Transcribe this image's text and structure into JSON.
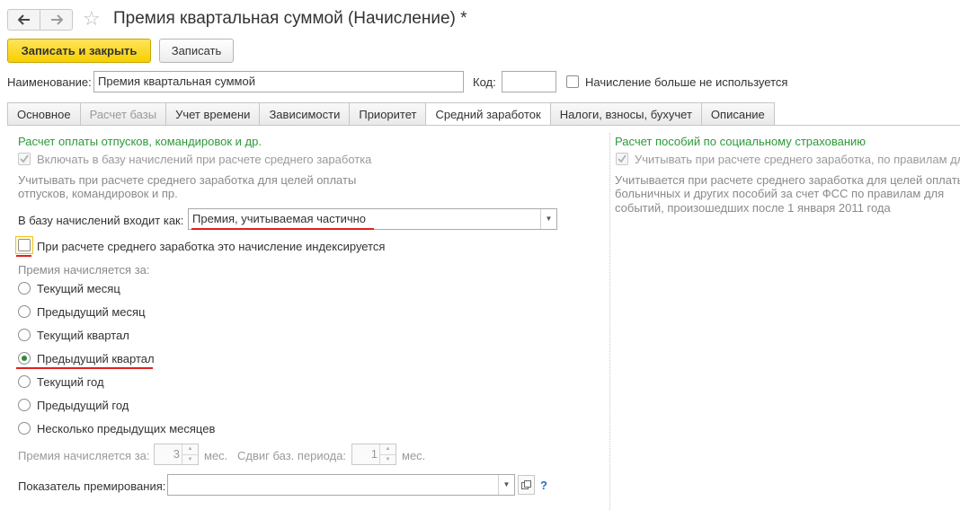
{
  "header": {
    "title": "Премия квартальная суммой (Начисление) *",
    "back_icon": "arrow-left-icon",
    "forward_icon": "arrow-right-icon",
    "favorite_icon": "star-icon"
  },
  "toolbar": {
    "save_close_label": "Записать и закрыть",
    "save_label": "Записать"
  },
  "top_fields": {
    "name_label": "Наименование:",
    "name_value": "Премия квартальная суммой",
    "code_label": "Код:",
    "code_value": "",
    "unused_label": "Начисление больше не используется"
  },
  "tabs": [
    {
      "label": "Основное"
    },
    {
      "label": "Расчет базы"
    },
    {
      "label": "Учет времени"
    },
    {
      "label": "Зависимости"
    },
    {
      "label": "Приоритет"
    },
    {
      "label": "Средний заработок"
    },
    {
      "label": "Налоги, взносы, бухучет"
    },
    {
      "label": "Описание"
    }
  ],
  "left": {
    "section_title": "Расчет оплаты отпусков, командировок и др.",
    "include_label": "Включать в базу начислений при расчете среднего заработка",
    "hint_line1": "Учитывать при расчете среднего заработка для целей оплаты",
    "hint_line2": "отпусков, командировок и пр.",
    "base_label": "В базу начислений входит как:",
    "base_value": "Премия, учитываемая частично",
    "indexed_label": "При расчете среднего заработка это начисление индексируется",
    "period_label": "Премия начисляется за:",
    "radio_options": [
      {
        "label": "Текущий месяц"
      },
      {
        "label": "Предыдущий месяц"
      },
      {
        "label": "Текущий квартал"
      },
      {
        "label": "Предыдущий квартал"
      },
      {
        "label": "Текущий год"
      },
      {
        "label": "Предыдущий год"
      },
      {
        "label": "Несколько предыдущих месяцев"
      }
    ],
    "selected_option": "Предыдущий квартал",
    "months_label": "Премия начисляется за:",
    "months_value": "3",
    "months_unit": "мес.",
    "shift_label": "Сдвиг баз. периода:",
    "shift_value": "1",
    "shift_unit": "мес.",
    "indicator_label": "Показатель премирования:",
    "indicator_value": "",
    "help": "?"
  },
  "right": {
    "section_title": "Расчет пособий по социальному страхованию",
    "consider_label": "Учитывать при расчете среднего заработка, по правилам дл",
    "hint_line1": "Учитывается при расчете среднего заработка для целей оплаты",
    "hint_line2": "больничных и других пособий за счет ФСС по правилам для",
    "hint_line3": "событий, произошедших после 1 января 2011 года"
  },
  "colors": {
    "accent_green": "#2c9a3a",
    "primary_button": "#f7cf00",
    "annotation_red": "#e02020"
  }
}
